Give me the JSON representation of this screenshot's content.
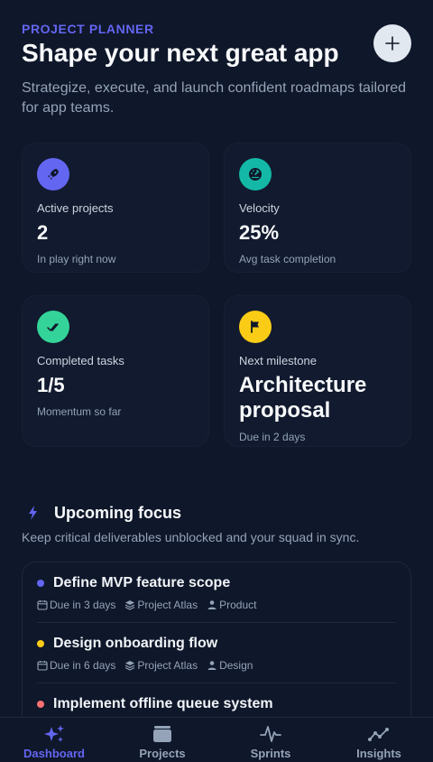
{
  "header": {
    "eyebrow": "PROJECT PLANNER",
    "title": "Shape your next great app",
    "subtitle": "Strategize, execute, and launch confident roadmaps tailored for app teams.",
    "add_icon": "plus-icon"
  },
  "stats": [
    {
      "icon": "rocket-icon",
      "color": "#6366f1",
      "label": "Active projects",
      "value": "2",
      "note": "In play right now"
    },
    {
      "icon": "speedometer-icon",
      "color": "#14b8a6",
      "label": "Velocity",
      "value": "25%",
      "note": "Avg task completion"
    },
    {
      "icon": "double-check-icon",
      "color": "#34d399",
      "label": "Completed tasks",
      "value": "1/5",
      "note": "Momentum so far"
    },
    {
      "icon": "flag-icon",
      "color": "#facc15",
      "label": "Next milestone",
      "value": "Architecture proposal",
      "note": "Due in 2 days"
    }
  ],
  "focus": {
    "icon": "lightning-icon",
    "title": "Upcoming focus",
    "subtitle": "Keep critical deliverables unblocked and your squad in sync.",
    "tasks": [
      {
        "title": "Define MVP feature scope",
        "dot": "#6366f1",
        "due": "Due in 3 days",
        "project": "Project Atlas",
        "owner": "Product"
      },
      {
        "title": "Design onboarding flow",
        "dot": "#facc15",
        "due": "Due in 6 days",
        "project": "Project Atlas",
        "owner": "Design"
      },
      {
        "title": "Implement offline queue system",
        "dot": "#f87171",
        "due": "",
        "project": "",
        "owner": ""
      }
    ]
  },
  "tabs": [
    {
      "label": "Dashboard",
      "icon": "sparkles-icon",
      "active": true
    },
    {
      "label": "Projects",
      "icon": "folder-stack-icon",
      "active": false
    },
    {
      "label": "Sprints",
      "icon": "pulse-icon",
      "active": false
    },
    {
      "label": "Insights",
      "icon": "trend-line-icon",
      "active": false
    }
  ],
  "colors": {
    "accent": "#6366f1",
    "background": "#0f172a"
  }
}
